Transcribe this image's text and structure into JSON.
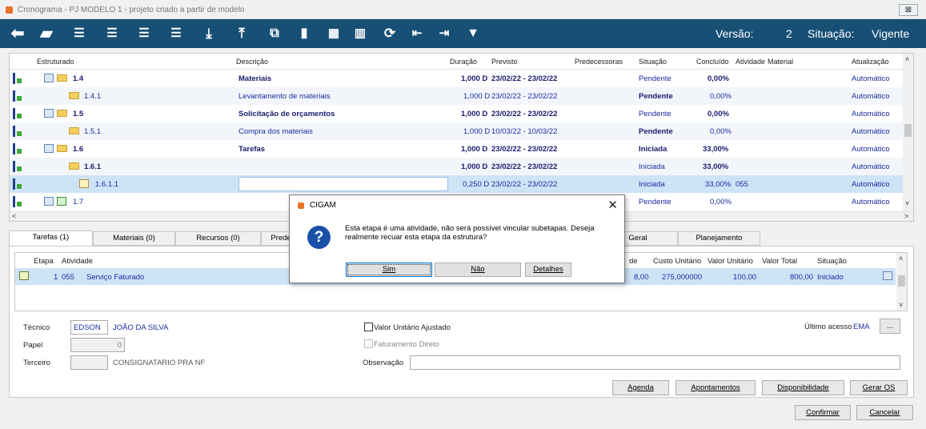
{
  "window": {
    "title": "Cronograma - PJ MODELO 1 - projeto criado a partir de modelo",
    "close": "⊠"
  },
  "toolbar": {
    "icons": [
      "back-icon",
      "add-folder-icon",
      "indent-icon",
      "indent-icon",
      "indent-icon",
      "indent-icon",
      "import-icon",
      "export-icon",
      "copy-icon",
      "clipboard-icon",
      "pages-icon",
      "chart-icon",
      "refresh-icon",
      "move-left-icon",
      "move-right-icon",
      "filter-icon"
    ],
    "versao_label": "Versão:",
    "versao_value": "2",
    "situacao_label": "Situação:",
    "situacao_value": "Vigente"
  },
  "grid": {
    "headers": [
      "Estruturado",
      "Descrição",
      "Duração",
      "Previsto",
      "Predecessoras",
      "Situação",
      "Concluído",
      "Atividade",
      "Material",
      "Atualização"
    ],
    "rows": [
      {
        "code": "1.4",
        "desc": "Materiais",
        "dur": "1,000 D",
        "prev": "23/02/22 - 23/02/22",
        "sit": "Pendente",
        "conc": "0,00%",
        "ativ": "",
        "atual": "Automático"
      },
      {
        "code": "1.4.1",
        "desc": "Levantamento de materiais",
        "dur": "1,000 D",
        "prev": "23/02/22   -   23/02/22",
        "sit": "Pendente",
        "conc": "0,00%",
        "ativ": "",
        "atual": "Automático"
      },
      {
        "code": "1.5",
        "desc": "Solicitação de orçamentos",
        "dur": "1,000 D",
        "prev": "23/02/22 - 23/02/22",
        "sit": "Pendente",
        "conc": "0,00%",
        "ativ": "",
        "atual": "Automático"
      },
      {
        "code": "1.5.1",
        "desc": "Compra dos materiais",
        "dur": "1,000 D",
        "prev": "10/03/22   -   10/03/22",
        "sit": "Pendente",
        "conc": "0,00%",
        "ativ": "",
        "atual": "Automático"
      },
      {
        "code": "1.6",
        "desc": "Tarefas",
        "dur": "1,000 D",
        "prev": "23/02/22 - 23/02/22",
        "sit": "Iniciada",
        "conc": "33,00%",
        "ativ": "",
        "atual": "Automático"
      },
      {
        "code": "1.6.1",
        "desc": "",
        "dur": "1,000 D",
        "prev": "23/02/22 - 23/02/22",
        "sit": "Iniciada",
        "conc": "33,00%",
        "ativ": "",
        "atual": "Automático"
      },
      {
        "code": "1.6.1.1",
        "desc": "",
        "dur": "0,250 D",
        "prev": "23/02/22   -   23/02/22",
        "sit": "Iniciada",
        "conc": "33,00%",
        "ativ": "055",
        "atual": "Automático"
      },
      {
        "code": "1.7",
        "desc": "",
        "dur": "",
        "prev": "",
        "sit": "Pendente",
        "conc": "0,00%",
        "ativ": "",
        "atual": "Automático"
      }
    ]
  },
  "tabs": [
    "Tarefas (1)",
    "Materiais (0)",
    "Recursos (0)",
    "Prede",
    "Geral",
    "Planejamento"
  ],
  "subgrid": {
    "headers": [
      "Etapa",
      "Atividade",
      "de",
      "Custo Unitário",
      "Valor Unitário",
      "Valor Total",
      "Situação"
    ],
    "row": {
      "etapa": "1",
      "ativ": "055",
      "ativ_desc": "Serviço Faturado",
      "qtd": "8,00",
      "custo": "275,000000",
      "vunit": "100,00",
      "vtotal": "800,00",
      "sit": "Iniciado"
    }
  },
  "form": {
    "tecnico_label": "Técnico",
    "tecnico_value": "EDSON",
    "tecnico_name": "JOÃO DA SILVA",
    "papel_label": "Papel",
    "papel_value": "0",
    "terceiro_label": "Terceiro",
    "terceiro_name": "CONSIGNATARIO PRA NF",
    "vua_label": "Valor Unitário Ajustado",
    "fd_label": "Faturamento Direto",
    "obs_label": "Observação",
    "ultimo_label": "Último acesso",
    "ultimo_value": "EMA",
    "ellipsis": "..."
  },
  "buttons": {
    "agenda": "Agenda",
    "apontamentos": "Apontamentos",
    "disponibilidade": "Disponibilidade",
    "geraros": "Gerar OS",
    "confirmar": "Confirmar",
    "cancelar": "Cancelar"
  },
  "dialog": {
    "title": "CIGAM",
    "message": "Esta etapa é uma atividade, não será possível vincular subetapas. Deseja realmente recuar esta etapa da estrutura?",
    "sim": "Sim",
    "nao": "Não",
    "detalhes": "Detalhes",
    "close": "✕",
    "icon": "?"
  }
}
